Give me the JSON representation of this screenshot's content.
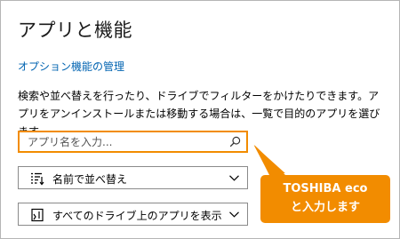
{
  "page": {
    "title": "アプリと機能",
    "manage_link": "オプション機能の管理",
    "description": "検索や並べ替えを行ったり、ドライブでフィルターをかけたりできます。アプリをアンインストールまたは移動する場合は、一覧で目的のアプリを選びます。"
  },
  "search": {
    "placeholder": "アプリ名を入力...",
    "value": "",
    "icon": "search-icon"
  },
  "sort": {
    "label": "名前で並べ替え",
    "icon": "sort-list-icon"
  },
  "filter": {
    "label": "すべてのドライブ上のアプリを表示",
    "icon": "drive-filter-icon"
  },
  "callout": {
    "line1": "TOSHIBA  eco",
    "line2": "と入力します",
    "color": "#f28c00"
  },
  "colors": {
    "accent_link": "#0063b1",
    "highlight": "#f28c00"
  }
}
